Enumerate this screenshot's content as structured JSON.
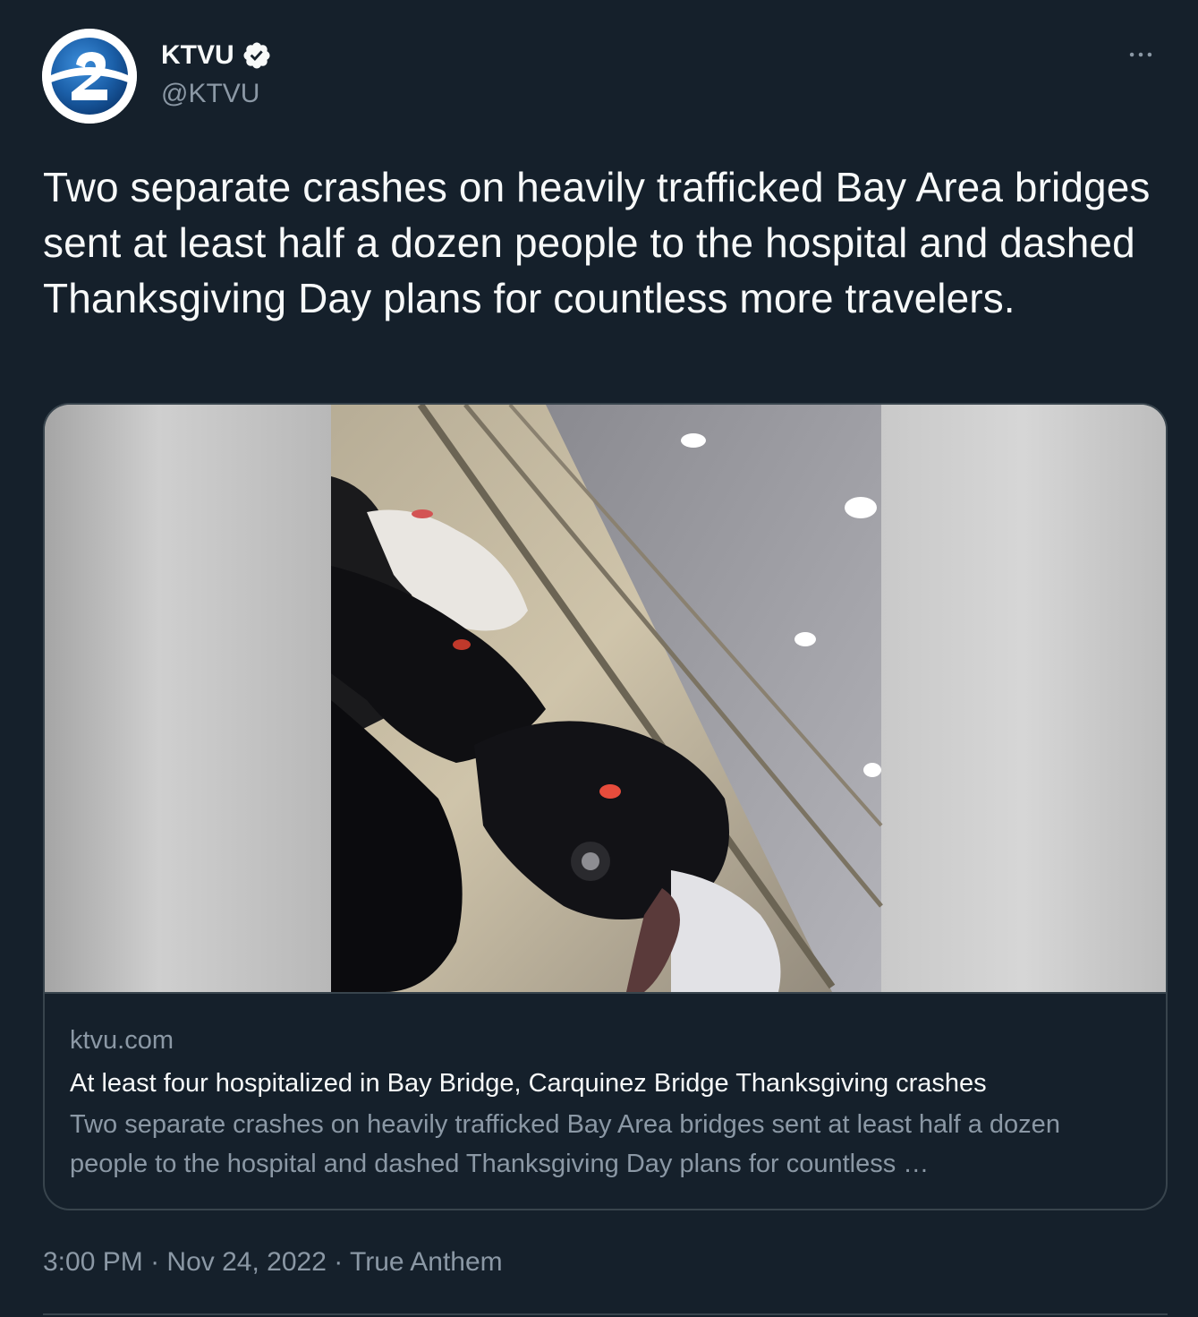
{
  "account": {
    "display_name": "KTVU",
    "handle": "@KTVU",
    "verified": true,
    "avatar_icon": "ktvu-2-logo-icon"
  },
  "more_icon": "ellipsis-icon",
  "tweet": {
    "text": "Two separate crashes on heavily trafficked Bay Area bridges sent at least half a dozen people to the hospital and dashed Thanksgiving Day plans for countless more travelers."
  },
  "card": {
    "domain": "ktvu.com",
    "title": "At least four hospitalized in Bay Bridge, Carquinez Bridge Thanksgiving crashes",
    "description": "Two separate crashes on heavily trafficked Bay Area bridges sent at least half a dozen people to the hospital and dashed Thanksgiving Day plans for countless …"
  },
  "meta": {
    "time": "3:00 PM",
    "separator": "·",
    "date": "Nov 24, 2022",
    "source": "True Anthem"
  },
  "colors": {
    "background": "#15202b",
    "text_primary": "#f7f9f9",
    "text_secondary": "#8b98a5",
    "border": "#38444d",
    "verified_badge": "#f7f9f9",
    "logo_blue": "#1b5fa8"
  }
}
